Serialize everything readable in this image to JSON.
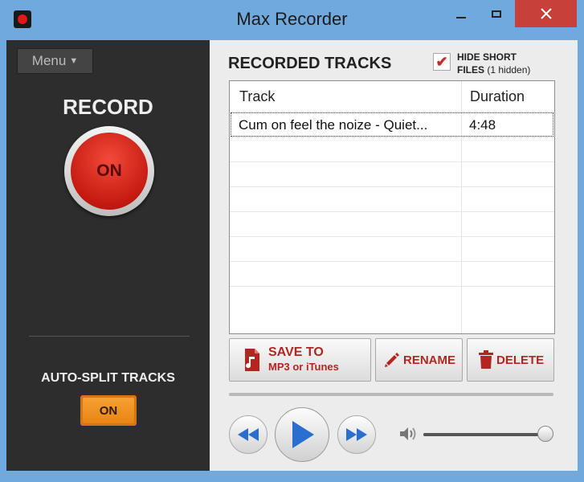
{
  "window": {
    "title": "Max Recorder"
  },
  "left_panel": {
    "menu_label": "Menu",
    "record_title": "RECORD",
    "record_state": "ON",
    "autosplit_label": "AUTO-SPLIT TRACKS",
    "autosplit_state": "ON"
  },
  "tracks": {
    "title": "RECORDED TRACKS",
    "hide_short": {
      "checked": true,
      "label_line1": "HIDE SHORT",
      "label_line2_bold": "FILES",
      "label_line2_rest": " (1 hidden)"
    },
    "columns": [
      "Track",
      "Duration"
    ],
    "rows": [
      {
        "track": "Cum on feel the noize - Quiet...",
        "duration": "4:48",
        "selected": true
      }
    ],
    "empty_rows": 7
  },
  "actions": {
    "save_line1": "SAVE TO",
    "save_line2": "MP3 or iTunes",
    "rename": "RENAME",
    "delete": "DELETE"
  },
  "player": {
    "volume": 1.0
  },
  "colors": {
    "accent_red": "#b52520",
    "record_red": "#c41a12",
    "autosplit_orange": "#e88412",
    "titlebar": "#6fa9dd",
    "play_blue": "#2a6fd0"
  }
}
